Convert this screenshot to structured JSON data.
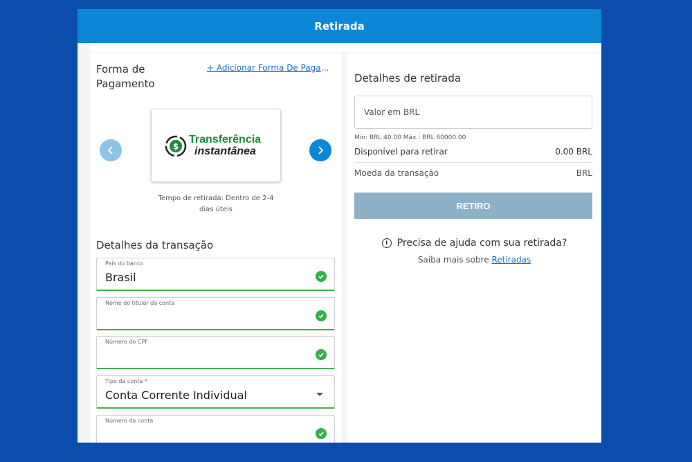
{
  "header": {
    "title": "Retirada"
  },
  "payment": {
    "title": "Forma de Pagamento",
    "add_link": "+ Adicionar Forma De Pagamento",
    "card": {
      "line1": "Transferência",
      "line2": "instantânea",
      "icon": "dollar-refresh-icon"
    },
    "withdraw_time": "Tempo de retirada: Dentro de 2-4 dias úteis"
  },
  "transaction": {
    "title": "Detalhes da transação",
    "fields": [
      {
        "label": "País do banco",
        "value": "Brasil"
      },
      {
        "label": "Nome do titular da conta",
        "value": ""
      },
      {
        "label": "Número do CPF",
        "value": ""
      },
      {
        "label": "Tipo da conta *",
        "value": "Conta Corrente Individual"
      },
      {
        "label": "Número da conta",
        "value": ""
      }
    ]
  },
  "withdraw": {
    "title": "Detalhes de retirada",
    "amount_placeholder": "Valor em BRL",
    "minmax": "Min: BRL 40.00 Máx.: BRL 60000.00",
    "available_label": "Disponível para retirar",
    "available_value": "0.00 BRL",
    "currency_label": "Moeda da transação",
    "currency_value": "BRL",
    "button": "RETIRO"
  },
  "help": {
    "question": "Precisa de ajuda com sua retirada?",
    "sub_prefix": "Saiba mais sobre",
    "sub_link": "Retiradas"
  },
  "colors": {
    "header": "#0c86d6",
    "background": "#0a4dab",
    "success": "#32b14a",
    "button": "#8eb1c8"
  }
}
